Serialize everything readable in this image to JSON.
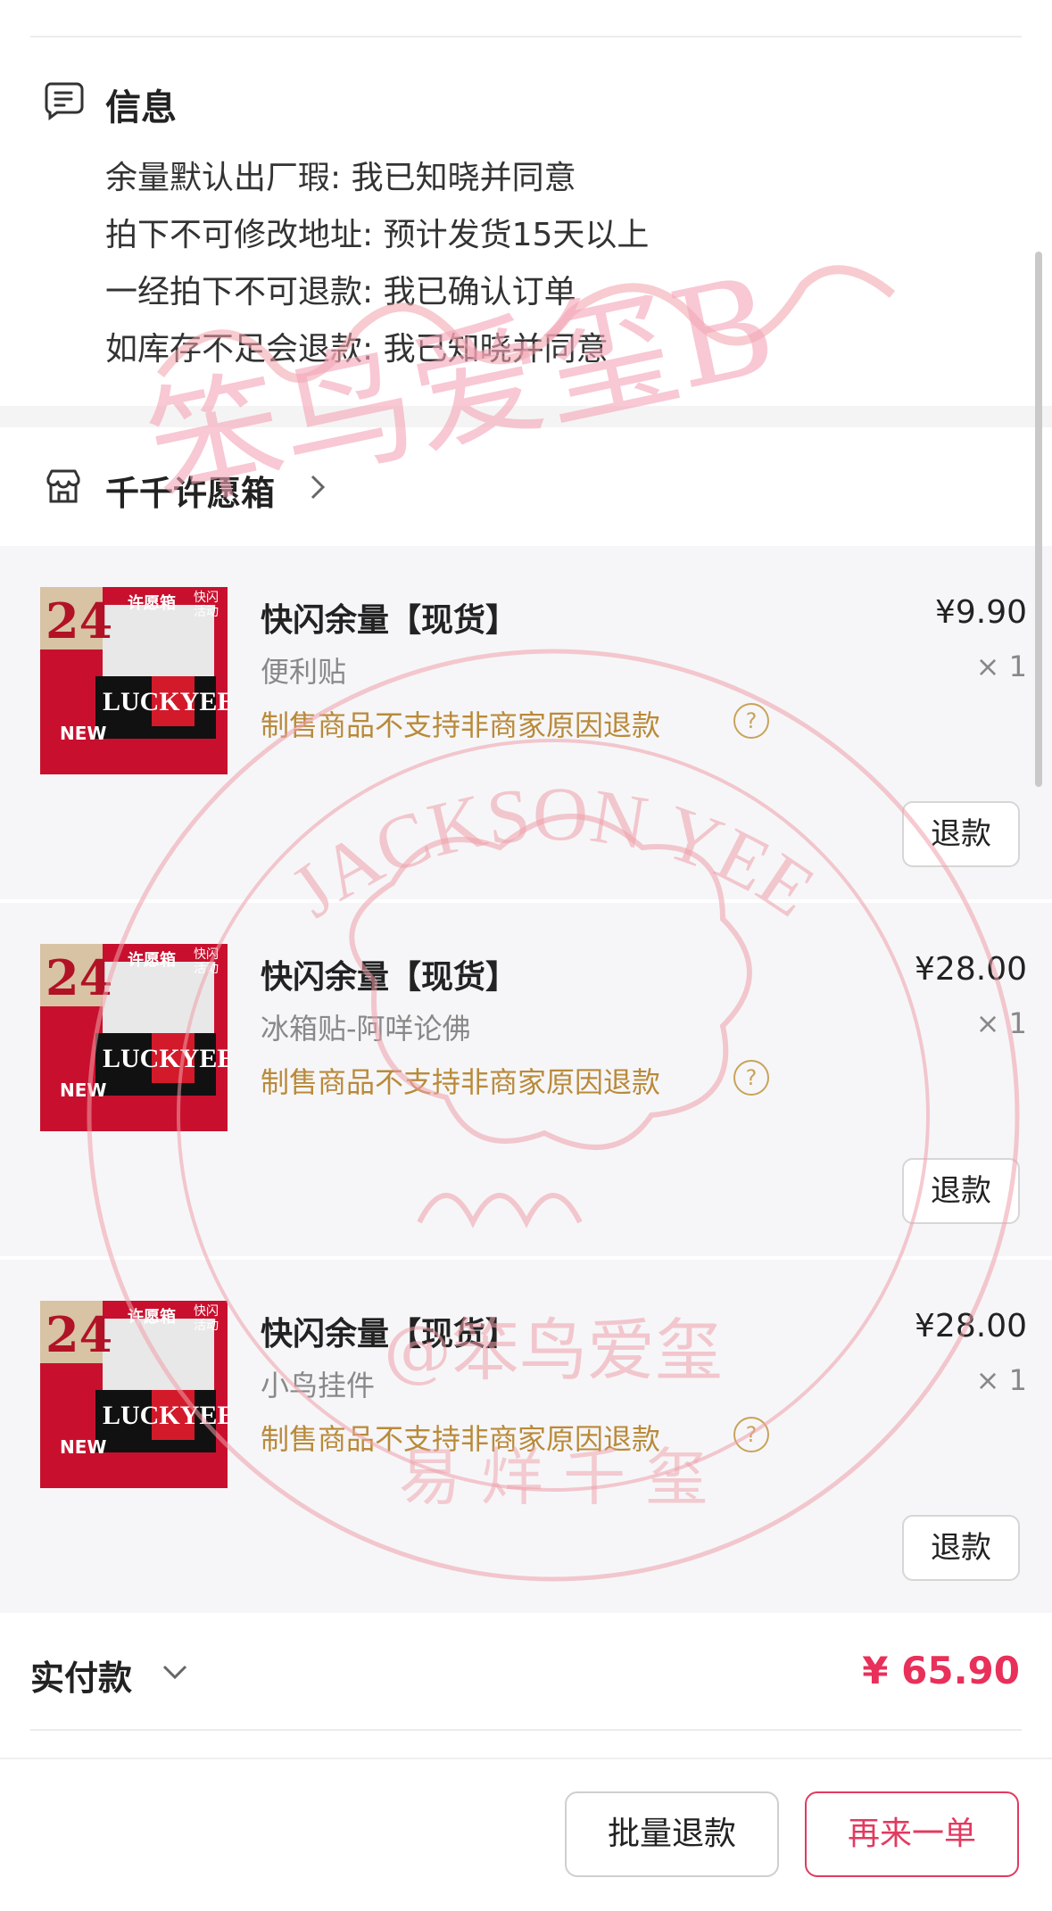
{
  "info": {
    "title": "信息",
    "lines": [
      "余量默认出厂瑕: 我已知晓并同意",
      "拍下不可修改地址: 预计发货15天以上",
      "一经拍下不可退款: 我已确认订单",
      "如库存不足会退款: 我已知晓并同意"
    ]
  },
  "store": {
    "name": "千千许愿箱"
  },
  "products": [
    {
      "title": "快闪余量【现货】",
      "spec": "便利贴",
      "note": "制售商品不支持非商家原因退款",
      "price": "¥9.90",
      "qty": "× 1",
      "refund": "退款"
    },
    {
      "title": "快闪余量【现货】",
      "spec": "冰箱贴-阿咩论佛",
      "note": "制售商品不支持非商家原因退款",
      "price": "¥28.00",
      "qty": "× 1",
      "refund": "退款"
    },
    {
      "title": "快闪余量【现货】",
      "spec": "小鸟挂件",
      "note": "制售商品不支持非商家原因退款",
      "price": "¥28.00",
      "qty": "× 1",
      "refund": "退款"
    }
  ],
  "thumbnail": {
    "number": "24",
    "tag": "许愿箱",
    "event": "快闪活动",
    "brand": "LUCKYEE",
    "badge": "NEW"
  },
  "payment": {
    "label": "实付款",
    "amount": "¥ 65.90"
  },
  "actions": {
    "batch_refund": "批量退款",
    "reorder": "再来一单"
  },
  "watermark": {
    "ring_text": "JACKSON YEE",
    "handwriting": "笨鸟爱玺B",
    "inner_text": "@笨鸟爱玺",
    "bottom_text": "易 烊 千 玺",
    "color": "#f0a0aa"
  },
  "colors": {
    "accent": "#e8305a",
    "note": "#b98a3a",
    "band": "#f6f6f8"
  }
}
